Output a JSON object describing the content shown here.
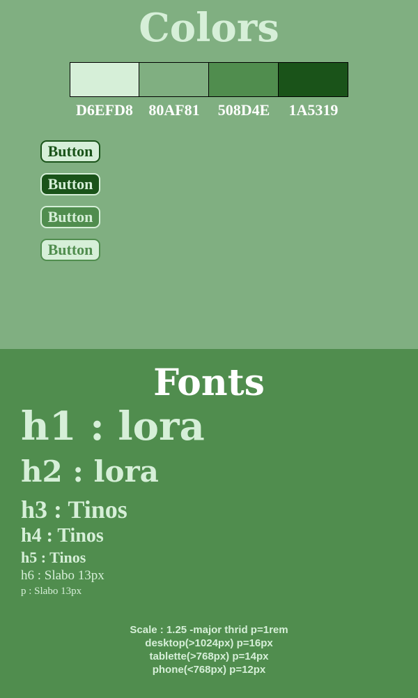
{
  "colors": {
    "title": "Colors",
    "swatches": [
      {
        "hex": "#D6EFD8",
        "label": "D6EFD8"
      },
      {
        "hex": "#80AF81",
        "label": "80AF81"
      },
      {
        "hex": "#508D4E",
        "label": "508D4E"
      },
      {
        "hex": "#1A5319",
        "label": "1A5319"
      }
    ]
  },
  "buttons": [
    {
      "label": "Button",
      "background": "#D6EFD8",
      "text_color": "#1A5319",
      "border_color": "#1A5319"
    },
    {
      "label": "Button",
      "background": "#1A5319",
      "text_color": "#D6EFD8",
      "border_color": "#D6EFD8"
    },
    {
      "label": "Button",
      "background": "#508D4E",
      "text_color": "#D6EFD8",
      "border_color": "#D6EFD8"
    },
    {
      "label": "Button",
      "background": "#D6EFD8",
      "text_color": "#508D4E",
      "border_color": "#508D4E"
    }
  ],
  "fonts": {
    "title": "Fonts",
    "samples": {
      "h1": "h1 : lora",
      "h2": "h2 : lora",
      "h3": "h3 : Tinos",
      "h4": "h4 : Tinos",
      "h5": "h5 : Tinos",
      "h6": "h6 : Slabo 13px",
      "p": "p : Slabo 13px"
    },
    "scale_notes": [
      "Scale : 1.25 -major thrid p=1rem",
      "desktop(>1024px) p=16px",
      "tablette(>768px) p=14px",
      "phone(<768px) p=12px"
    ]
  },
  "theme": {
    "top_background": "#80AF81",
    "bottom_background": "#508D4E",
    "light": "#D6EFD8",
    "dark": "#1A5319"
  }
}
